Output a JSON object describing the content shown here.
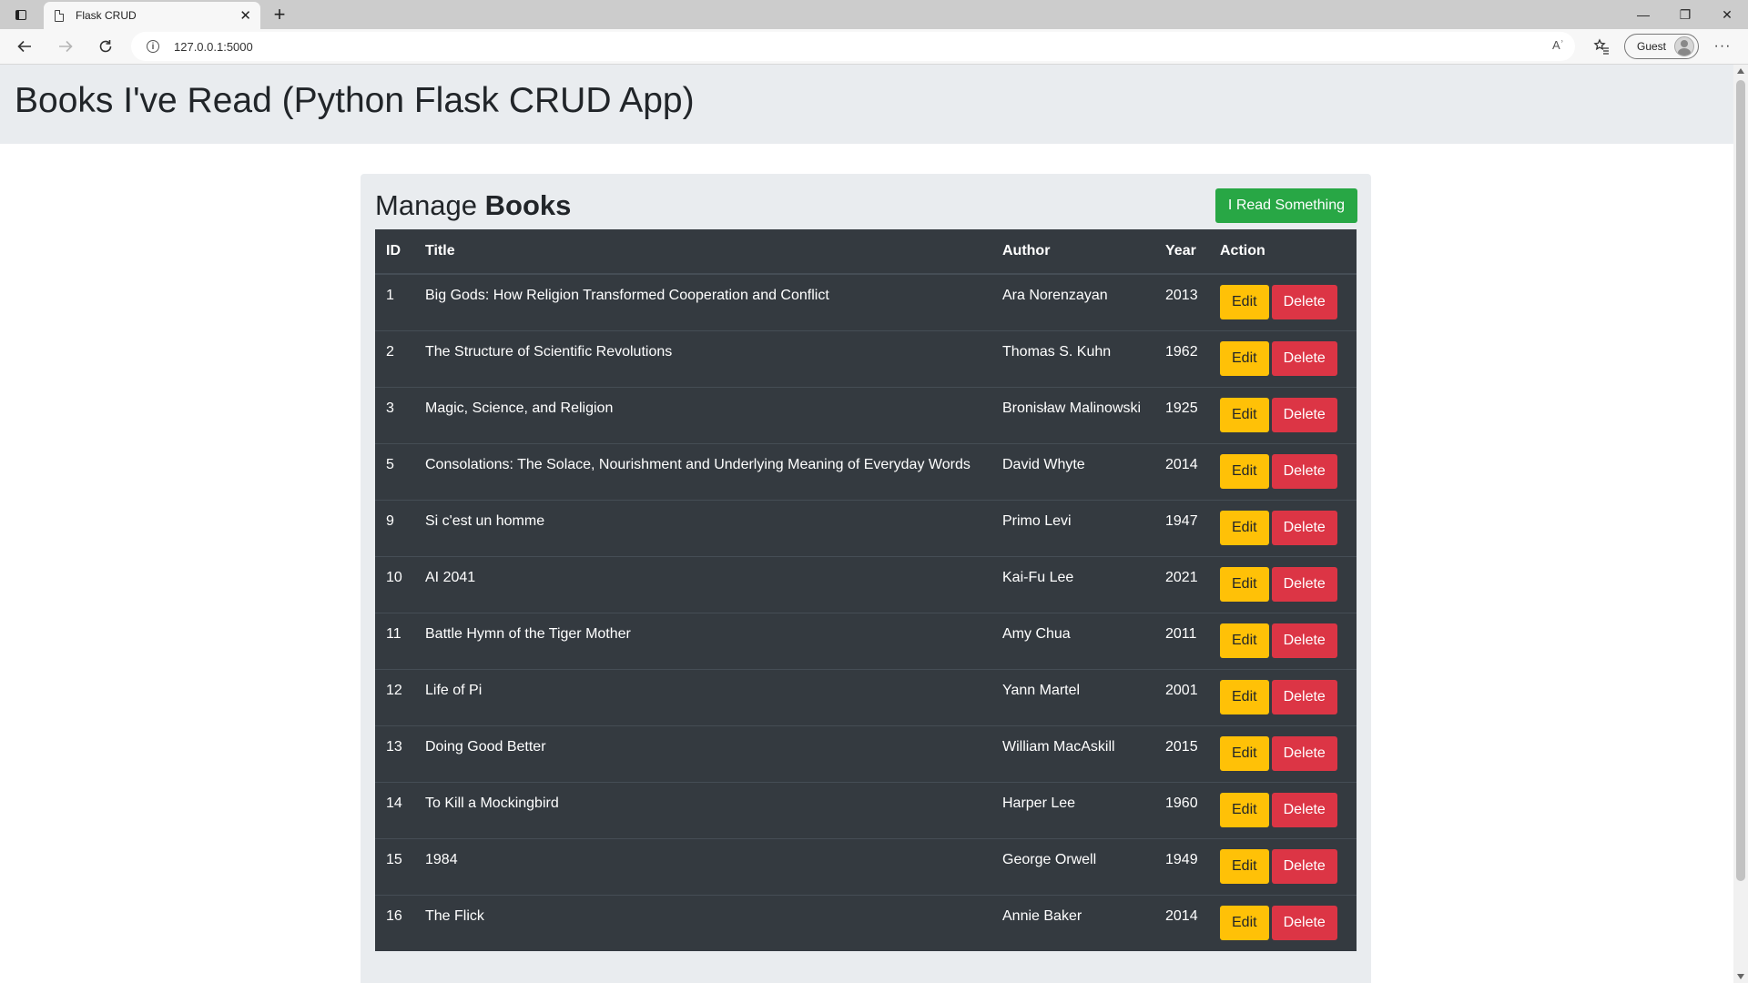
{
  "browser": {
    "tab_title": "Flask CRUD",
    "tab_close": "✕",
    "new_tab": "+",
    "url": "127.0.0.1:5000",
    "read_aloud": "Aʾ",
    "profile_label": "Guest",
    "window": {
      "minimize": "—",
      "restore": "❐",
      "close": "✕"
    },
    "icons": {
      "back": "back-arrow-icon",
      "forward": "forward-arrow-icon",
      "reload": "reload-icon",
      "info": "info-icon",
      "favorites": "favorites-icon",
      "more": "more-icon"
    }
  },
  "page": {
    "heading": "Books I've Read (Python Flask CRUD App)",
    "manage_prefix": "Manage",
    "manage_bold": "Books",
    "add_button": "I Read Something"
  },
  "table": {
    "headers": {
      "id": "ID",
      "title": "Title",
      "author": "Author",
      "year": "Year",
      "action": "Action"
    },
    "edit_label": "Edit",
    "delete_label": "Delete",
    "rows": [
      {
        "id": "1",
        "title": "Big Gods: How Religion Transformed Cooperation and Conflict",
        "author": "Ara Norenzayan",
        "year": "2013"
      },
      {
        "id": "2",
        "title": "The Structure of Scientific Revolutions",
        "author": "Thomas S. Kuhn",
        "year": "1962"
      },
      {
        "id": "3",
        "title": "Magic, Science, and Religion",
        "author": "Bronisław Malinowski",
        "year": "1925"
      },
      {
        "id": "5",
        "title": "Consolations: The Solace, Nourishment and Underlying Meaning of Everyday Words",
        "author": "David Whyte",
        "year": "2014"
      },
      {
        "id": "9",
        "title": "Si c'est un homme",
        "author": "Primo Levi",
        "year": "1947"
      },
      {
        "id": "10",
        "title": "AI 2041",
        "author": "Kai-Fu Lee",
        "year": "2021"
      },
      {
        "id": "11",
        "title": "Battle Hymn of the Tiger Mother",
        "author": "Amy Chua",
        "year": "2011"
      },
      {
        "id": "12",
        "title": "Life of Pi",
        "author": "Yann Martel",
        "year": "2001"
      },
      {
        "id": "13",
        "title": "Doing Good Better",
        "author": "William MacAskill",
        "year": "2015"
      },
      {
        "id": "14",
        "title": "To Kill a Mockingbird",
        "author": "Harper Lee",
        "year": "1960"
      },
      {
        "id": "15",
        "title": "1984",
        "author": "George Orwell",
        "year": "1949"
      },
      {
        "id": "16",
        "title": "The Flick",
        "author": "Annie Baker",
        "year": "2014"
      }
    ]
  },
  "colors": {
    "jumbotron_bg": "#e9ecef",
    "table_bg": "#343a40",
    "add_button": "#28a745",
    "edit_button": "#ffc107",
    "delete_button": "#dc3545"
  }
}
